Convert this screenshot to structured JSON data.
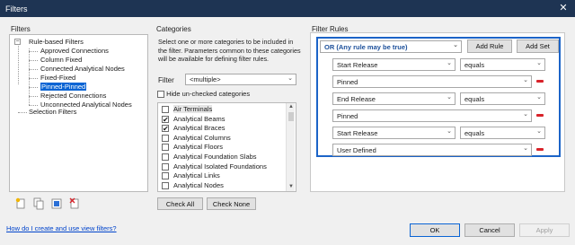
{
  "window": {
    "title": "Filters"
  },
  "filters": {
    "heading": "Filters",
    "tree": {
      "rule_based_label": "Rule-based Filters",
      "children": [
        "Approved Connections",
        "Column Fixed",
        "Connected Analytical Nodes",
        "Fixed-Fixed",
        "Pinned-Pinned",
        "Rejected Connections",
        "Unconnected Analytical Nodes"
      ],
      "selected_index": 4,
      "selection_filters_label": "Selection Filters"
    },
    "toolbar_icons": [
      "new-filter-icon",
      "duplicate-icon",
      "rename-icon",
      "delete-icon"
    ]
  },
  "categories": {
    "heading": "Categories",
    "description": "Select one or more categories to be included in the filter.  Parameters common to these categories will be available for defining filter rules.",
    "filter_label": "Filter",
    "filter_value": "<multiple>",
    "hide_unchecked_label": "Hide un-checked categories",
    "items": [
      {
        "label": "Air Terminals",
        "checked": false
      },
      {
        "label": "Analytical Beams",
        "checked": true
      },
      {
        "label": "Analytical Braces",
        "checked": true
      },
      {
        "label": "Analytical Columns",
        "checked": false
      },
      {
        "label": "Analytical Floors",
        "checked": false
      },
      {
        "label": "Analytical Foundation Slabs",
        "checked": false
      },
      {
        "label": "Analytical Isolated Foundations",
        "checked": false
      },
      {
        "label": "Analytical Links",
        "checked": false
      },
      {
        "label": "Analytical Nodes",
        "checked": false
      }
    ],
    "check_all_label": "Check All",
    "check_none_label": "Check None"
  },
  "filter_rules": {
    "heading": "Filter Rules",
    "logic_value": "OR (Any rule may be true)",
    "add_rule_label": "Add Rule",
    "add_set_label": "Add Set",
    "rules": [
      {
        "parameter": "Start Release",
        "operator": "equals",
        "value": "Pinned"
      },
      {
        "parameter": "End Release",
        "operator": "equals",
        "value": "Pinned"
      },
      {
        "parameter": "Start Release",
        "operator": "equals",
        "value": "User Defined"
      }
    ]
  },
  "footer": {
    "help_link": "How do I create and use view filters?",
    "ok_label": "OK",
    "cancel_label": "Cancel",
    "apply_label": "Apply"
  },
  "colors": {
    "title_bar": "#1e3453",
    "selection": "#0a64d4",
    "rules_border": "#1c64c8",
    "remove_red": "#d8232a"
  }
}
